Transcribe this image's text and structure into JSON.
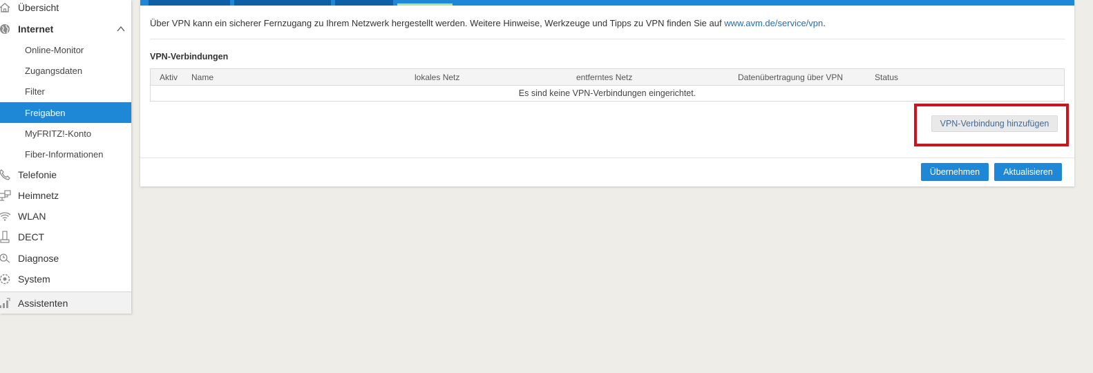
{
  "sidebar": {
    "items": [
      {
        "label": "Übersicht",
        "icon": "home-icon"
      },
      {
        "label": "Internet",
        "icon": "globe-icon",
        "expanded": true
      },
      {
        "label": "Telefonie",
        "icon": "phone-icon"
      },
      {
        "label": "Heimnetz",
        "icon": "network-icon"
      },
      {
        "label": "WLAN",
        "icon": "wifi-icon"
      },
      {
        "label": "DECT",
        "icon": "dect-icon"
      },
      {
        "label": "Diagnose",
        "icon": "diagnose-icon"
      },
      {
        "label": "System",
        "icon": "system-icon"
      },
      {
        "label": "Assistenten",
        "icon": "wizard-icon"
      }
    ],
    "internet_sub": [
      {
        "label": "Online-Monitor"
      },
      {
        "label": "Zugangsdaten"
      },
      {
        "label": "Filter"
      },
      {
        "label": "Freigaben",
        "active": true
      },
      {
        "label": "MyFRITZ!-Konto"
      },
      {
        "label": "Fiber-Informationen"
      }
    ]
  },
  "main": {
    "intro_text": "Über VPN kann ein sicherer Fernzugang zu Ihrem Netzwerk hergestellt werden. Weitere Hinweise, Werkzeuge und Tipps zu VPN finden Sie auf ",
    "intro_link": "www.avm.de/service/vpn",
    "intro_end": ".",
    "section_title": "VPN-Verbindungen",
    "table": {
      "columns": [
        "Aktiv",
        "Name",
        "lokales Netz",
        "entferntes Netz",
        "Datenübertragung über VPN",
        "Status"
      ],
      "empty_message": "Es sind keine VPN-Verbindungen eingerichtet."
    },
    "add_button": "VPN-Verbindung hinzufügen",
    "apply_button": "Übernehmen",
    "refresh_button": "Aktualisieren"
  },
  "colors": {
    "accent": "#1e88d7",
    "highlight": "#d0121b",
    "background": "#efede8"
  }
}
